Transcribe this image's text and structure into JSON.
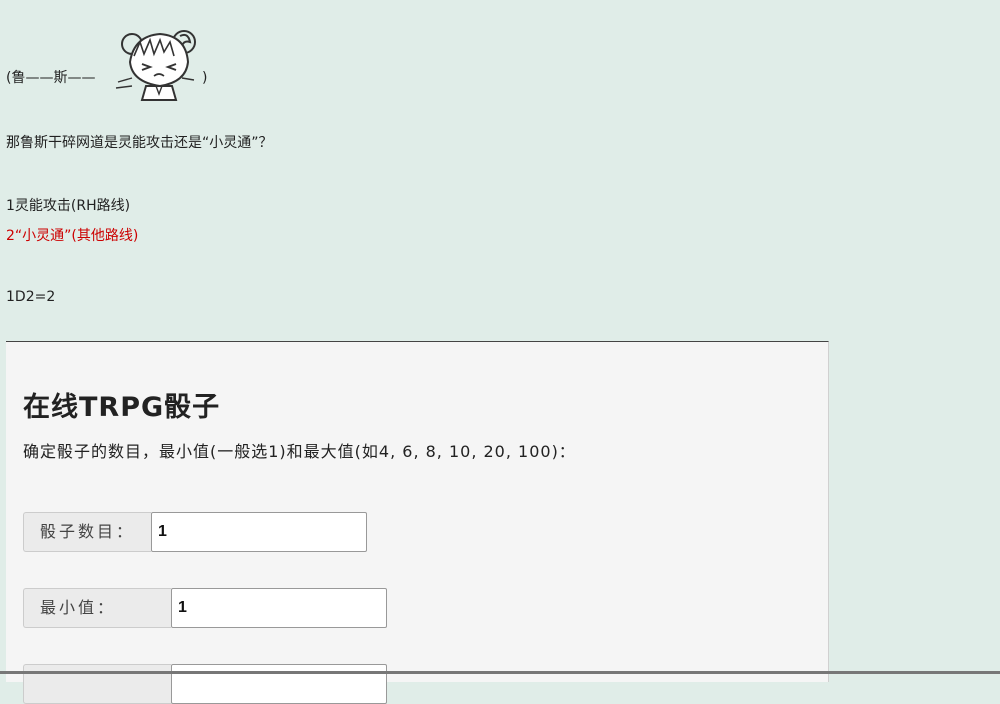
{
  "post": {
    "sticker_open": "(鲁——斯——",
    "sticker_close": ")",
    "question": "那鲁斯干碎网道是灵能攻击还是“小灵通”？",
    "option1": "1灵能攻击(RH路线)",
    "option2": "2“小灵通”(其他路线)",
    "roll": "1D2=2"
  },
  "dice": {
    "title": "在线TRPG骰子",
    "desc": "确定骰子的数目，最小值(一般选1)和最大值(如4, 6, 8, 10, 20, 100)：",
    "fields": [
      {
        "label": "骰子数目：",
        "value": "1"
      },
      {
        "label": "最小值：",
        "value": "1"
      },
      {
        "label": "",
        "value": ""
      }
    ]
  },
  "colors": {
    "page_bg": "#e0ede8",
    "highlight_red": "#cc0000",
    "panel_bg": "#f5f5f5"
  }
}
